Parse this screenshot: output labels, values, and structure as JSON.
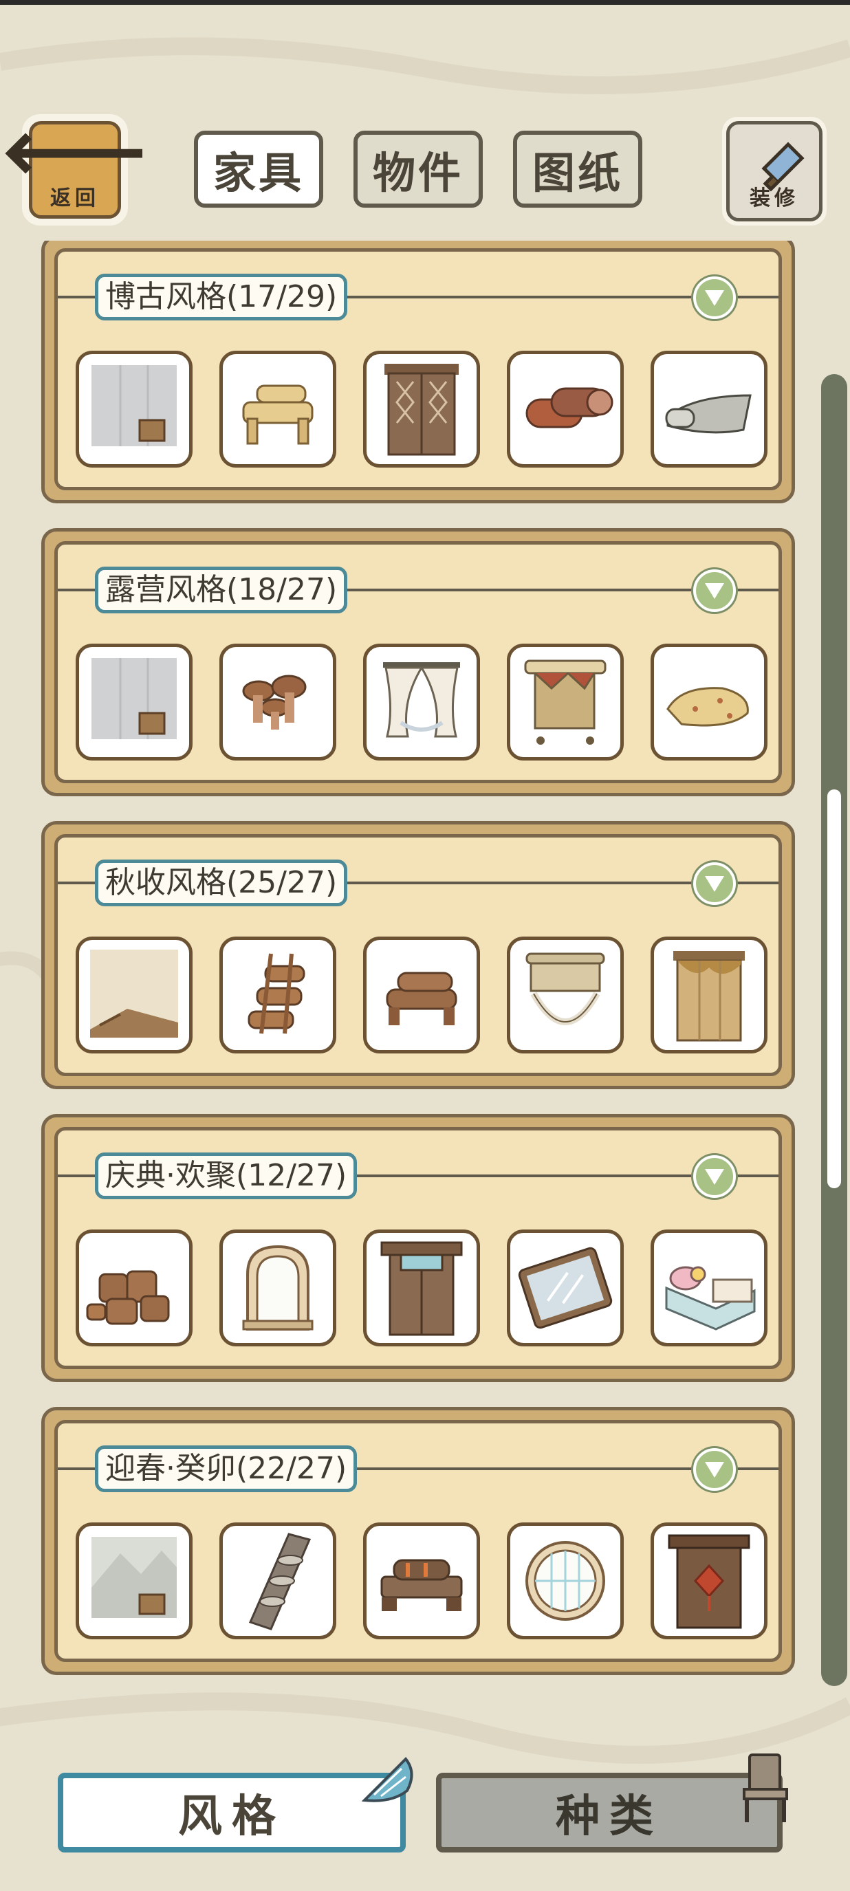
{
  "header": {
    "back_label": "返回",
    "tabs": [
      {
        "label": "家具",
        "active": true
      },
      {
        "label": "物件",
        "active": false
      },
      {
        "label": "图纸",
        "active": false
      }
    ],
    "decorate_label": "装修"
  },
  "style_sets": [
    {
      "title": "博古风格(17/29)",
      "items": [
        "wall-panel-icon",
        "log-bench-icon",
        "lattice-door-icon",
        "rolled-rug-icon",
        "scroll-icon"
      ]
    },
    {
      "title": "露营风格(18/27)",
      "items": [
        "wall-panel-icon",
        "mushroom-stools-icon",
        "curtain-window-icon",
        "banner-rack-icon",
        "sleeping-bag-icon"
      ]
    },
    {
      "title": "秋收风格(25/27)",
      "items": [
        "beige-wallpaper-icon",
        "log-ladder-icon",
        "log-bench-icon",
        "roller-blind-icon",
        "hay-door-icon"
      ]
    },
    {
      "title": "庆典·欢聚(12/27)",
      "items": [
        "barrels-icon",
        "arched-window-icon",
        "wooden-door-icon",
        "mirror-frame-icon",
        "bed-icon"
      ]
    },
    {
      "title": "迎春·癸卯(22/27)",
      "items": [
        "mountain-wallpaper-icon",
        "shelf-ladder-icon",
        "log-stove-icon",
        "round-window-icon",
        "knot-door-icon"
      ]
    }
  ],
  "bottom_tabs": [
    {
      "label": "风格",
      "active": true
    },
    {
      "label": "种类",
      "active": false
    }
  ],
  "colors": {
    "card_outer": "#cfae75",
    "card_inner": "#f4e3b8",
    "title_border": "#4b8a96",
    "toggle_green": "#a8c185",
    "active_tab_border": "#3f8aa0"
  }
}
